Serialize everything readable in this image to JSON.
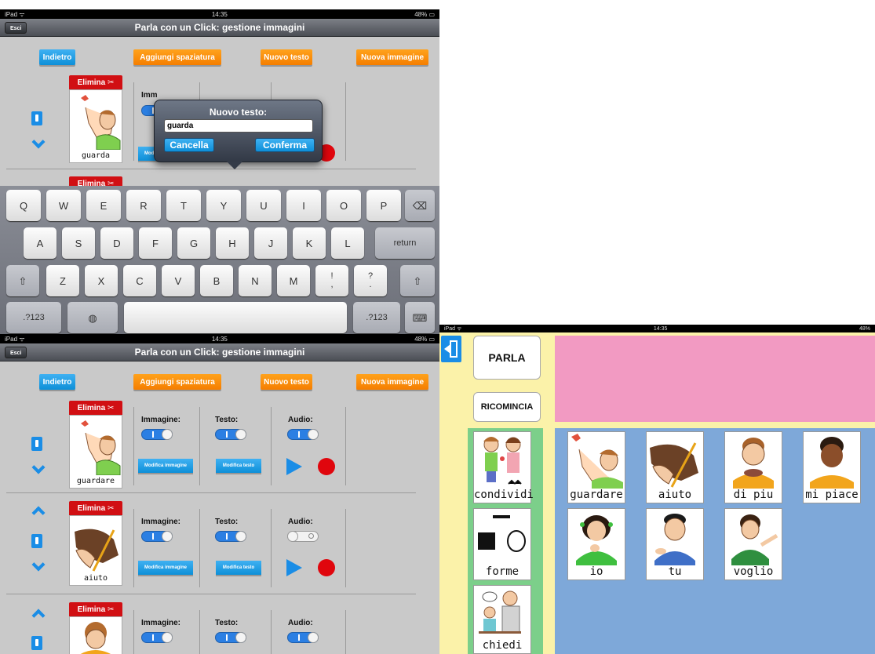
{
  "status_top": {
    "left": "iPad ᯤ",
    "time": "14:35",
    "battery": "48% ▭"
  },
  "status_bottom": {
    "left": "iPad ᯤ",
    "time": "14:35",
    "battery": "48% ▭"
  },
  "status_right": {
    "left": "iPad ᯤ",
    "time": "14:35",
    "battery": "48%"
  },
  "manager": {
    "exit_label": "Esci",
    "title": "Parla con un Click: gestione immagini",
    "back_label": "Indietro",
    "add_spacing_label": "Aggiungi spaziatura",
    "new_text_label": "Nuovo testo",
    "new_image_label": "Nuova immagine",
    "delete_label": "Elimina ✂",
    "image_col": "Immagine:",
    "text_col": "Testo:",
    "audio_col": "Audio:",
    "edit_image_label": "Modifica immagine",
    "edit_text_label": "Modifica testo",
    "image_col_partial": "Imm"
  },
  "top_items": [
    {
      "word": "guarda"
    }
  ],
  "bottom_items": [
    {
      "word": "guardare",
      "image_on": true,
      "text_on": true,
      "audio_on": true
    },
    {
      "word": "aiuto",
      "image_on": true,
      "text_on": true,
      "audio_on": false
    },
    {
      "word": "",
      "image_on": true,
      "text_on": true,
      "audio_on": true
    }
  ],
  "popover": {
    "title": "Nuovo testo:",
    "value": "guarda",
    "cancel_label": "Cancella",
    "confirm_label": "Conferma"
  },
  "keyboard": {
    "row1": [
      "Q",
      "W",
      "E",
      "R",
      "T",
      "Y",
      "U",
      "I",
      "O",
      "P"
    ],
    "row2": [
      "A",
      "S",
      "D",
      "F",
      "G",
      "H",
      "J",
      "K",
      "L"
    ],
    "row3": [
      "Z",
      "X",
      "C",
      "V",
      "B",
      "N",
      "M",
      "!\n,",
      "?\n."
    ],
    "return_label": "return",
    "numbers_label": ".?123",
    "backspace_icon": "⌫",
    "shift_icon": "⇧",
    "globe_icon": "◍",
    "hide_icon": "⌨"
  },
  "board": {
    "speak_label": "PARLA",
    "restart_label": "RICOMINCIA",
    "categories": [
      {
        "word": "condividi"
      },
      {
        "word": "forme"
      },
      {
        "word": "chiedi"
      }
    ],
    "symbols": [
      {
        "word": "guardare"
      },
      {
        "word": "aiuto"
      },
      {
        "word": "di piu"
      },
      {
        "word": "mi piace"
      },
      {
        "word": "io"
      },
      {
        "word": "tu"
      },
      {
        "word": "voglio"
      }
    ],
    "colors": {
      "sentence_bar": "#f29ac2",
      "side_bg": "#fbf2a9",
      "category_bg": "#7ccf8a",
      "grid_bg": "#7ea8d9"
    }
  }
}
